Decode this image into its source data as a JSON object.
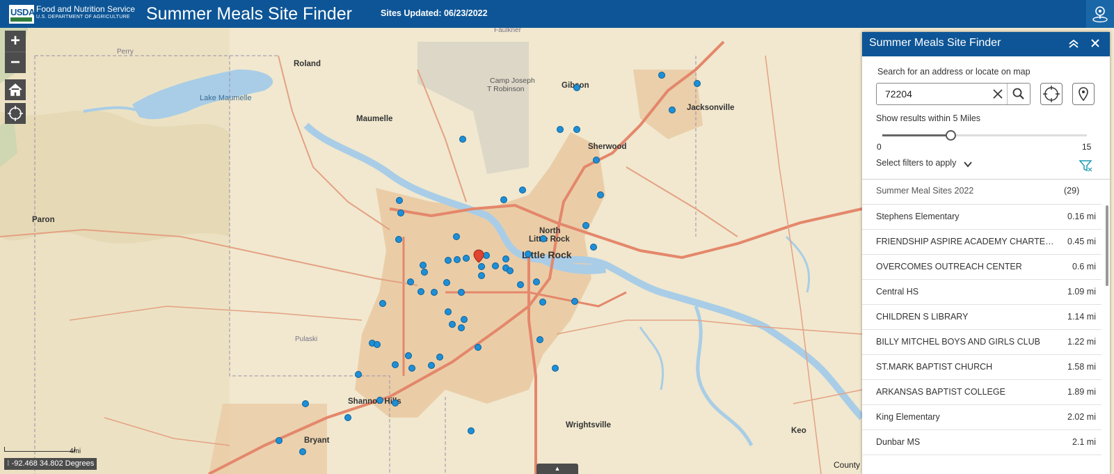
{
  "header": {
    "logo_text": "USDA",
    "agency": "Food and Nutrition Service",
    "department": "U.S. DEPARTMENT OF AGRICULTURE",
    "title": "Summer Meals Site Finder",
    "updated": "Sites Updated: 06/23/2022"
  },
  "map": {
    "labels": {
      "roland": "Roland",
      "lake_maumelle": "Lake Maumelle",
      "maumelle": "Maumelle",
      "camp_robinson": "Camp Joseph",
      "camp_robinson2": "T Robinson",
      "gibson": "Gibson",
      "jacksonville": "Jacksonville",
      "sherwood": "Sherwood",
      "paron": "Paron",
      "north_little_rock": "North",
      "north_little_rock2": "Little Rock",
      "little_rock": "Little Rock",
      "shannon_hills": "Shannon Hills",
      "bryant": "Bryant",
      "wrightsville": "Wrightsville",
      "keo": "Keo",
      "pulaski": "Pulaski",
      "perry": "Perry",
      "faulkner": "Faulkner"
    },
    "scale_label": "4mi",
    "coordinates": "-92.468 34.802 Degrees",
    "attribution": "County"
  },
  "panel": {
    "title": "Summer Meals Site Finder",
    "search_label": "Search for an address or locate on map",
    "search_value": "72204",
    "radius_label": "Show results within 5 Miles",
    "radius_value": 5,
    "radius_min": "0",
    "radius_max": "15",
    "filter_label": "Select filters to apply",
    "list_header": "Summer Meal Sites 2022",
    "list_count": "(29)",
    "sites": [
      {
        "name": "Stephens Elementary",
        "distance": "0.16 mi"
      },
      {
        "name": "FRIENDSHIP ASPIRE ACADEMY CHARTER SCHOOL",
        "distance": "0.45 mi"
      },
      {
        "name": "OVERCOMES OUTREACH CENTER",
        "distance": "0.6 mi"
      },
      {
        "name": "Central HS",
        "distance": "1.09 mi"
      },
      {
        "name": "CHILDREN S LIBRARY",
        "distance": "1.14 mi"
      },
      {
        "name": "BILLY MITCHEL BOYS AND GIRLS CLUB",
        "distance": "1.22 mi"
      },
      {
        "name": "ST.MARK BAPTIST CHURCH",
        "distance": "1.58 mi"
      },
      {
        "name": "ARKANSAS BAPTIST COLLEGE",
        "distance": "1.89 mi"
      },
      {
        "name": "King Elementary",
        "distance": "2.02 mi"
      },
      {
        "name": "Dunbar MS",
        "distance": "2.1 mi"
      }
    ]
  },
  "colors": {
    "header": "#0d5596",
    "site_marker": "#1e8fd6",
    "selected_marker": "#e0432f"
  }
}
